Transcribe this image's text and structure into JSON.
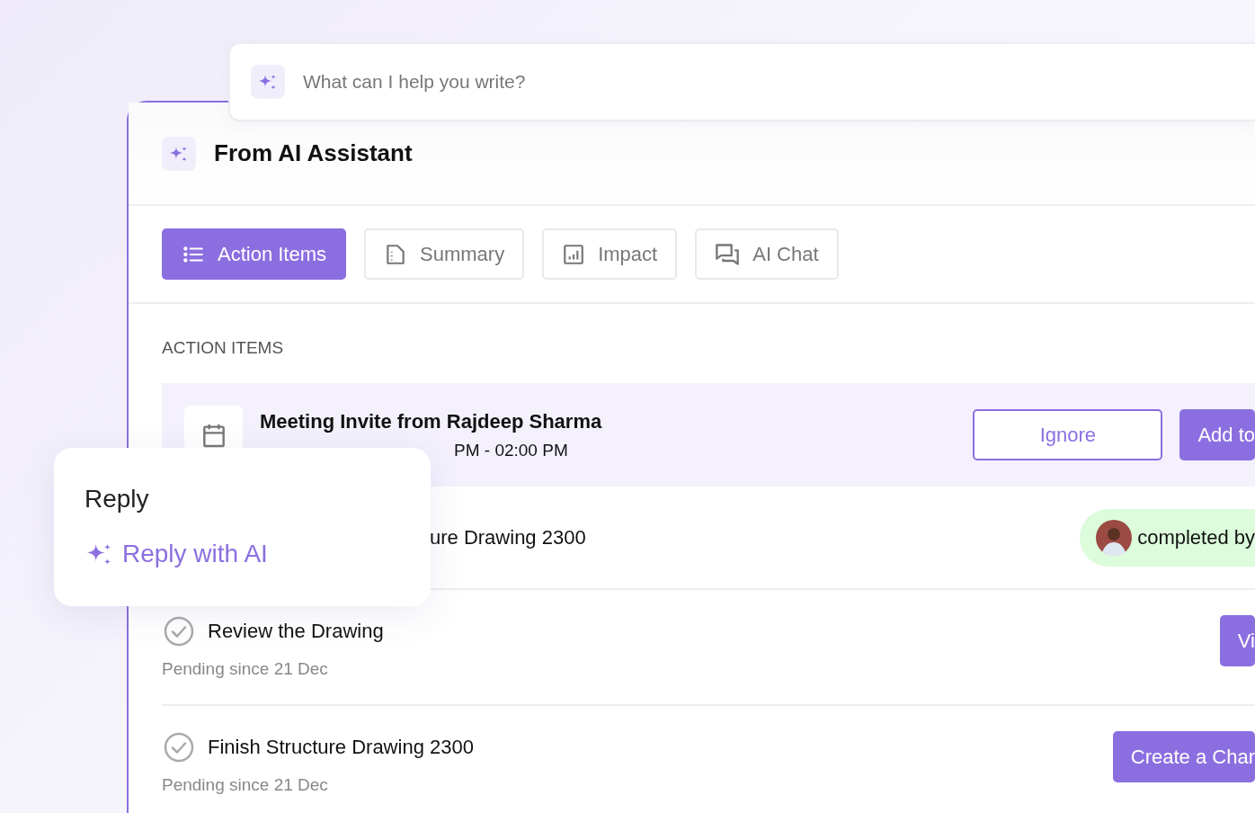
{
  "prompt": {
    "placeholder": "What can I help you write?"
  },
  "header": {
    "title": "From AI Assistant"
  },
  "tabs": [
    {
      "label": "Action Items",
      "selected": true
    },
    {
      "label": "Summary",
      "selected": false
    },
    {
      "label": "Impact",
      "selected": false
    },
    {
      "label": "AI Chat",
      "selected": false
    }
  ],
  "section_title": "ACTION ITEMS",
  "items": [
    {
      "kind": "meeting",
      "highlighted": true,
      "title": "Meeting Invite from Rajdeep Sharma",
      "subtitle": "PM - 02:00 PM",
      "actions": [
        {
          "kind": "outline",
          "label": "Ignore"
        },
        {
          "kind": "filled",
          "label": "Add to"
        }
      ]
    },
    {
      "kind": "covered",
      "highlighted": false,
      "title": "ure Drawing 2300",
      "actions": [
        {
          "kind": "status",
          "label": "completed by"
        }
      ]
    },
    {
      "kind": "task",
      "highlighted": false,
      "title": "Review the Drawing",
      "subtitle": "Pending since 21 Dec",
      "actions": [
        {
          "kind": "filled",
          "label": "Vi"
        }
      ]
    },
    {
      "kind": "task",
      "highlighted": false,
      "title": "Finish Structure Drawing 2300",
      "subtitle": "Pending since 21 Dec",
      "actions": [
        {
          "kind": "filled",
          "label": "Create a Char"
        }
      ]
    }
  ],
  "popup": {
    "title": "Reply",
    "option": "Reply with AI"
  }
}
